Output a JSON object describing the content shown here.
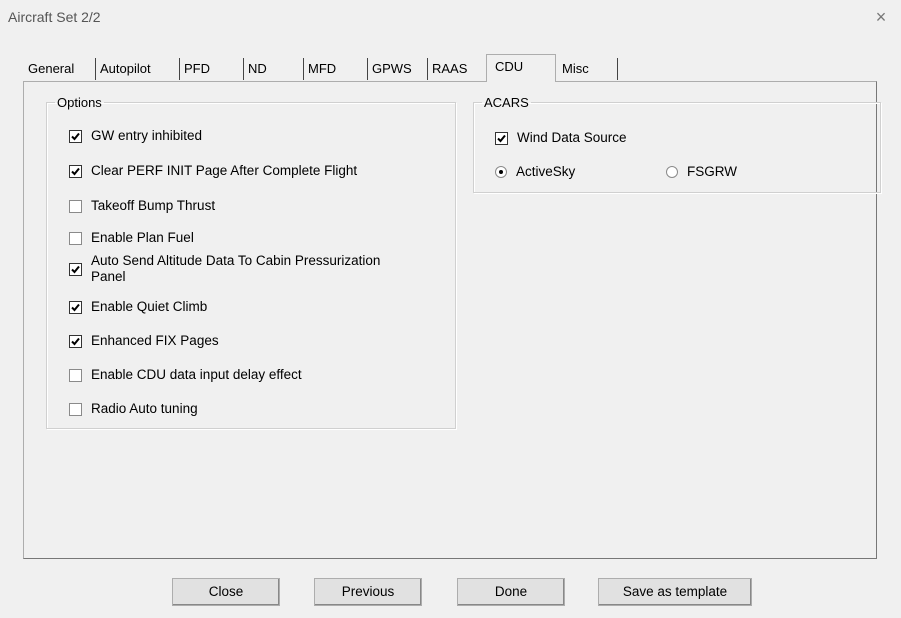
{
  "window": {
    "title": "Aircraft Set 2/2",
    "close_glyph": "×"
  },
  "tabs": [
    {
      "label": "General",
      "active": false
    },
    {
      "label": "Autopilot",
      "active": false
    },
    {
      "label": "PFD",
      "active": false
    },
    {
      "label": "ND",
      "active": false
    },
    {
      "label": "MFD",
      "active": false
    },
    {
      "label": "GPWS",
      "active": false
    },
    {
      "label": "RAAS",
      "active": false
    },
    {
      "label": "CDU",
      "active": true
    },
    {
      "label": "Misc",
      "active": false
    }
  ],
  "options": {
    "legend": "Options",
    "items": [
      {
        "label": "GW entry inhibited",
        "checked": true
      },
      {
        "label": "Clear PERF INIT Page After Complete Flight",
        "checked": true
      },
      {
        "label": "Takeoff Bump Thrust",
        "checked": false
      },
      {
        "label": "Enable Plan Fuel",
        "checked": false
      },
      {
        "label": "Auto Send Altitude Data To Cabin Pressurization",
        "label_line2": "Panel",
        "checked": true
      },
      {
        "label": "Enable Quiet Climb",
        "checked": true
      },
      {
        "label": "Enhanced FIX Pages",
        "checked": true
      },
      {
        "label": "Enable CDU data input delay effect",
        "checked": false
      },
      {
        "label": "Radio Auto tuning",
        "checked": false
      }
    ]
  },
  "acars": {
    "legend": "ACARS",
    "wind_data_source": {
      "label": "Wind Data Source",
      "checked": true
    },
    "radios": [
      {
        "label": "ActiveSky",
        "selected": true
      },
      {
        "label": "FSGRW",
        "selected": false
      }
    ]
  },
  "buttons": {
    "close": "Close",
    "previous": "Previous",
    "done": "Done",
    "save_template": "Save as template"
  }
}
